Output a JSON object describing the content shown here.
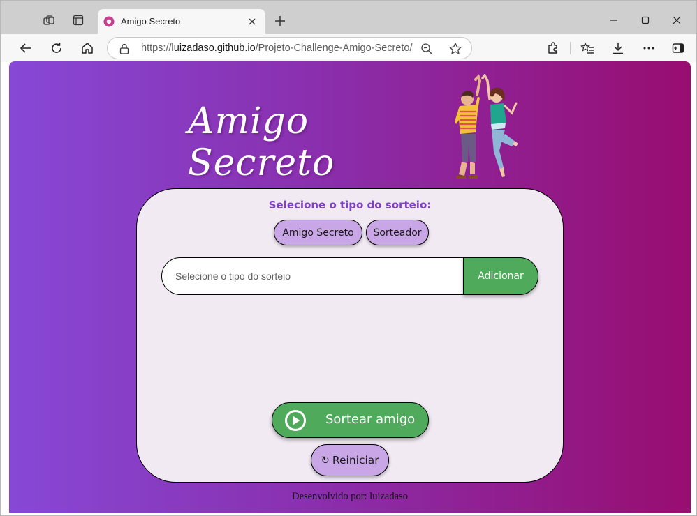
{
  "browser": {
    "tab": {
      "title": "Amigo Secreto"
    },
    "url": {
      "protocol": "https://",
      "host": "luizadaso.github.io",
      "path": "/Projeto-Challenge-Amigo-Secreto/"
    },
    "icons": [
      "workspaces-icon",
      "tab-actions-icon",
      "new-tab-icon",
      "minimize-icon",
      "maximize-icon",
      "close-icon",
      "back-icon",
      "refresh-icon",
      "home-icon",
      "lock-icon",
      "zoom-icon",
      "favorite-icon",
      "extensions-icon",
      "favorites-list-icon",
      "downloads-icon",
      "more-icon",
      "sidebar-icon"
    ]
  },
  "app": {
    "title": "Amigo Secreto",
    "heading": "Selecione o tipo do sorteio:",
    "type_buttons": [
      "Amigo Secreto",
      "Sorteador"
    ],
    "input_placeholder": "Selecione o tipo do sorteio",
    "add_label": "Adicionar",
    "draw_label": "Sortear amigo",
    "reset_label": "Reiniciar",
    "footer": "Desenvolvido por: luizadaso"
  },
  "colors": {
    "gradient_start": "#8748d6",
    "gradient_end": "#980d70",
    "card_bg": "#f1eaf3",
    "accent_purple": "#7e3fc9",
    "button_purple": "#c9a6e6",
    "button_green": "#4faa5b"
  }
}
